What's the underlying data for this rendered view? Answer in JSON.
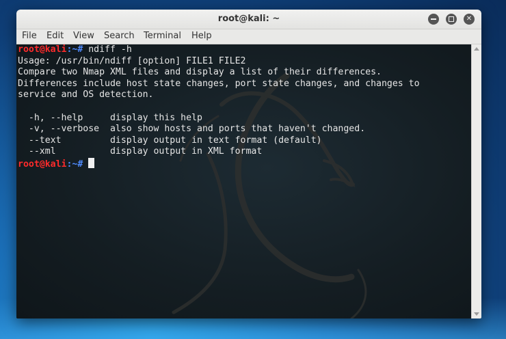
{
  "window": {
    "title": "root@kali: ~",
    "controls": {
      "minimize_icon": "minimize-icon",
      "maximize_icon": "maximize-icon",
      "close_icon": "close-icon",
      "close_glyph": "✕"
    }
  },
  "menu": {
    "items": [
      {
        "label": "File"
      },
      {
        "label": "Edit"
      },
      {
        "label": "View"
      },
      {
        "label": "Search"
      },
      {
        "label": "Terminal"
      },
      {
        "label": "Help"
      }
    ]
  },
  "terminal": {
    "prompt_user": "root@kali",
    "prompt_path": ":~#",
    "command": " ndiff -h",
    "output": [
      "Usage: /usr/bin/ndiff [option] FILE1 FILE2",
      "Compare two Nmap XML files and display a list of their differences.",
      "Differences include host state changes, port state changes, and changes to",
      "service and OS detection.",
      "",
      "  -h, --help     display this help",
      "  -v, --verbose  also show hosts and ports that haven't changed.",
      "  --text         display output in text format (default)",
      "  --xml          display output in XML format"
    ],
    "colors": {
      "prompt_user": "#ff2b2b",
      "prompt_path": "#4f8bff",
      "text": "#e6e6e6",
      "background": "#141d22"
    }
  }
}
